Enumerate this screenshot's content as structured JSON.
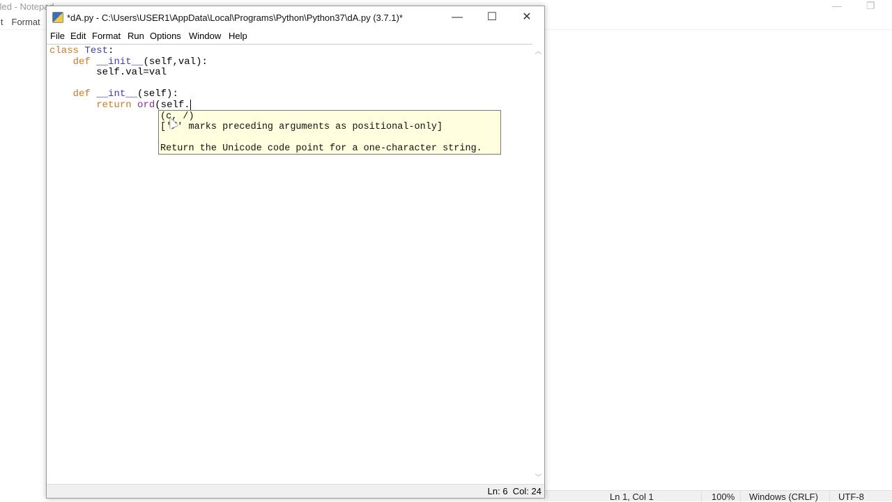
{
  "background_notepad": {
    "title": "tled - Notepad",
    "menu": [
      "it",
      "Format"
    ],
    "status": {
      "position": "Ln 1, Col 1",
      "zoom": "100%",
      "line_ending": "Windows (CRLF)",
      "encoding": "UTF-8"
    },
    "controls": {
      "minimize": "—",
      "restore": "❐"
    }
  },
  "window": {
    "title": "*dA.py - C:\\Users\\USER1\\AppData\\Local\\Programs\\Python\\Python37\\dA.py (3.7.1)*",
    "controls": {
      "minimize": "—",
      "maximize": "☐",
      "close": "✕"
    },
    "menu": [
      "File",
      "Edit",
      "Format",
      "Run",
      "Options",
      "Window",
      "Help"
    ],
    "code": [
      [
        {
          "c": "kw",
          "t": "class"
        },
        {
          "c": "tx",
          "t": " "
        },
        {
          "c": "def",
          "t": "Test"
        },
        {
          "c": "tx",
          "t": ":"
        }
      ],
      [
        {
          "c": "tx",
          "t": "    "
        },
        {
          "c": "kw",
          "t": "def"
        },
        {
          "c": "tx",
          "t": " "
        },
        {
          "c": "def",
          "t": "__init__"
        },
        {
          "c": "tx",
          "t": "(self,val):"
        }
      ],
      [
        {
          "c": "tx",
          "t": "        self.val=val"
        }
      ],
      [
        {
          "c": "tx",
          "t": ""
        }
      ],
      [
        {
          "c": "tx",
          "t": "    "
        },
        {
          "c": "kw",
          "t": "def"
        },
        {
          "c": "tx",
          "t": " "
        },
        {
          "c": "def",
          "t": "__int__"
        },
        {
          "c": "tx",
          "t": "(self):"
        }
      ],
      [
        {
          "c": "tx",
          "t": "        "
        },
        {
          "c": "kw",
          "t": "return"
        },
        {
          "c": "tx",
          "t": " "
        },
        {
          "c": "bi",
          "t": "ord"
        },
        {
          "c": "tx",
          "t": "(self."
        }
      ]
    ],
    "calltip": {
      "signature": "(c, /)",
      "note": "['/' marks preceding arguments as positional-only]",
      "doc": "Return the Unicode code point for a one-character string."
    },
    "status": "Ln: 6  Col: 24",
    "scroll": {
      "up": "︿",
      "down": "﹀"
    }
  }
}
